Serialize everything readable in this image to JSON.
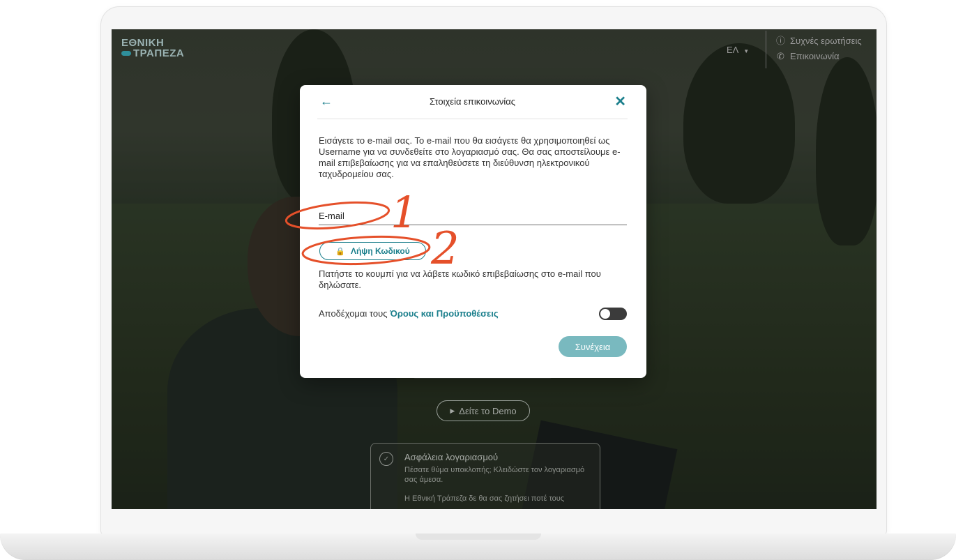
{
  "header": {
    "logo_line1": "ΕΘΝΙΚΗ",
    "logo_line2": "ΤΡΑΠΕΖΑ",
    "language": "ΕΛ",
    "faq_label": "Συχνές ερωτήσεις",
    "contact_label": "Επικοινωνία"
  },
  "background_page": {
    "demo_button_label": "Δείτε το Demo",
    "security_title": "Ασφάλεια λογαριασμού",
    "security_text": "Πέσατε θύμα υποκλοπής; Κλειδώστε τον λογαριασμό σας άμεσα.",
    "security_text2": "Η Εθνική Τράπεζα δε θα σας ζητήσει ποτέ τους"
  },
  "modal": {
    "title": "Στοιχεία επικοινωνίας",
    "intro": "Εισάγετε το e-mail σας. Το e-mail που θα εισάγετε θα χρησιμοποιηθεί ως Username για να συνδεθείτε στο λογαριασμό σας. Θα σας αποστείλουμε e-mail επιβεβαίωσης για να επαληθεύσετε τη διεύθυνση ηλεκτρονικού ταχυδρομείου σας.",
    "email_label": "E-mail",
    "email_value": "",
    "get_code_label": "Λήψη Κωδικού",
    "helper_text": "Πατήστε το κουμπί για να λάβετε κωδικό επιβεβαίωσης στο e-mail που δηλώσατε.",
    "terms_prefix": "Αποδέχομαι τους ",
    "terms_link": "Όρους και Προϋποθέσεις",
    "terms_accepted": false,
    "continue_label": "Συνέχεια"
  },
  "annotations": {
    "step1": "1",
    "step2": "2",
    "color": "#e5502a"
  },
  "colors": {
    "accent": "#1b7f8c",
    "continue_disabled": "#79b9bf"
  }
}
